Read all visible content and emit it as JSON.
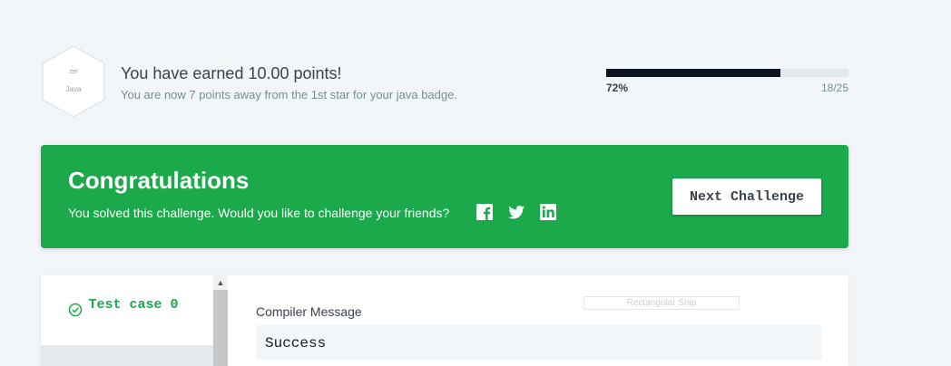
{
  "badge": {
    "icon": "java-cup-icon",
    "label": "Java"
  },
  "summary": {
    "earned": "You have earned 10.00 points!",
    "away": "You are now 7 points away from the 1st star for your java badge."
  },
  "progress": {
    "percent_label": "72%",
    "count_label": "18/25",
    "fraction": 0.72
  },
  "banner": {
    "title": "Congratulations",
    "subtitle": "You solved this challenge. Would you like to challenge your friends?",
    "social": [
      "facebook-icon",
      "twitter-icon",
      "linkedin-icon"
    ],
    "next_button": "Next Challenge",
    "color": "#1ba94c"
  },
  "test_cases": [
    {
      "label": "Test case 0",
      "status": "passed"
    }
  ],
  "compiler": {
    "label": "Compiler Message",
    "value": "Success"
  },
  "overlay": {
    "snip_label": "Rectangular Snip"
  }
}
